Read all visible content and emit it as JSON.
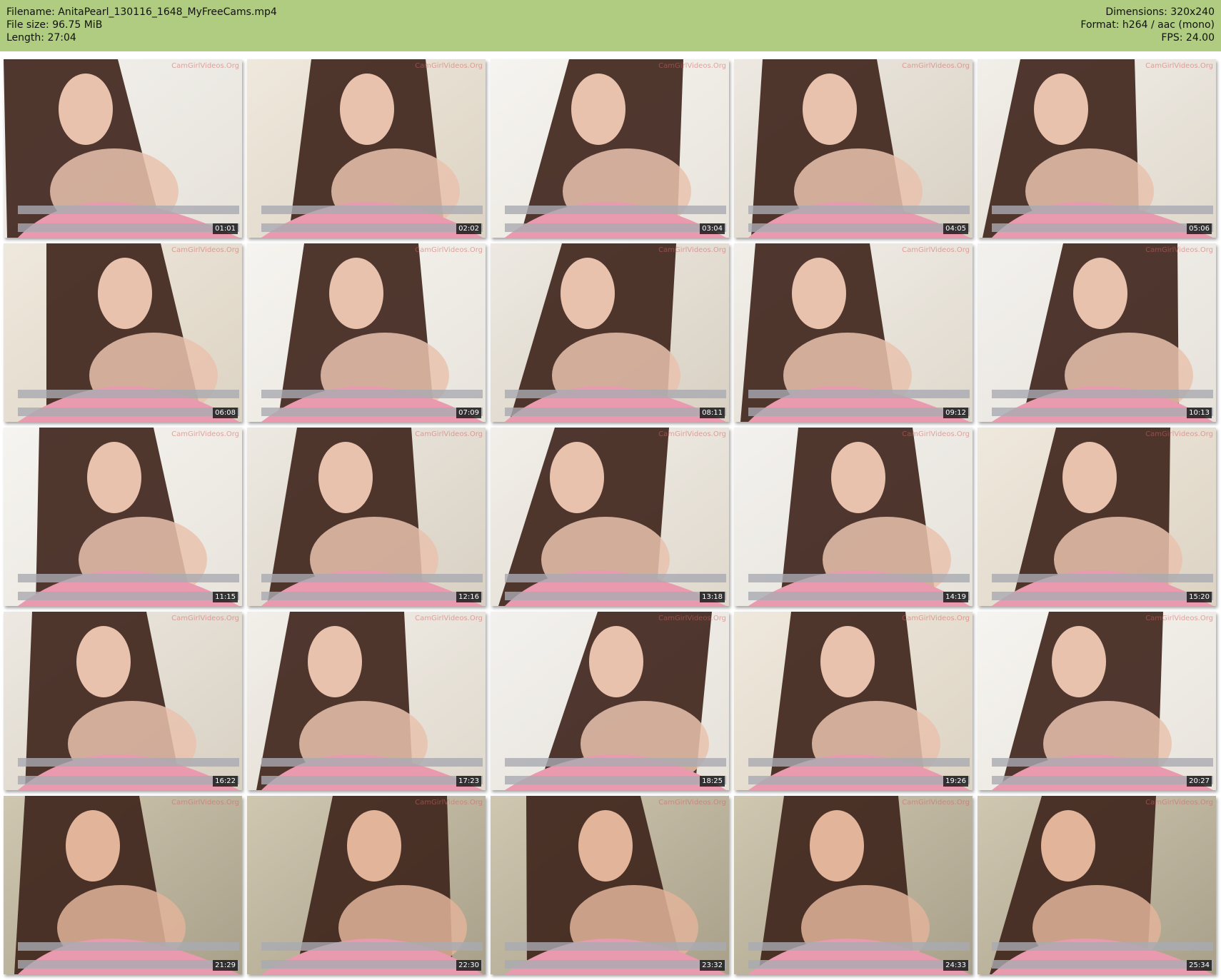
{
  "file_info": {
    "filename_line": "Filename: AnitaPearl_130116_1648_MyFreeCams.mp4",
    "filesize_line": "File size: 96.75 MiB",
    "length_line": "Length: 27:04",
    "dimensions_line": "Dimensions: 320x240",
    "format_line": "Format: h264 / aac (mono)",
    "fps_line": "FPS: 24.00"
  },
  "watermark": "CamGirlVideos.Org",
  "colors": {
    "header_bg": "#b0cc80",
    "timestamp_bg": "#000000"
  },
  "thumbnails": [
    {
      "timestamp": "01:01"
    },
    {
      "timestamp": "02:02"
    },
    {
      "timestamp": "03:04"
    },
    {
      "timestamp": "04:05"
    },
    {
      "timestamp": "05:06"
    },
    {
      "timestamp": "06:08"
    },
    {
      "timestamp": "07:09"
    },
    {
      "timestamp": "08:11"
    },
    {
      "timestamp": "09:12"
    },
    {
      "timestamp": "10:13"
    },
    {
      "timestamp": "11:15"
    },
    {
      "timestamp": "12:16"
    },
    {
      "timestamp": "13:18"
    },
    {
      "timestamp": "14:19"
    },
    {
      "timestamp": "15:20"
    },
    {
      "timestamp": "16:22"
    },
    {
      "timestamp": "17:23"
    },
    {
      "timestamp": "18:25"
    },
    {
      "timestamp": "19:26"
    },
    {
      "timestamp": "20:27"
    },
    {
      "timestamp": "21:29"
    },
    {
      "timestamp": "22:30"
    },
    {
      "timestamp": "23:32"
    },
    {
      "timestamp": "24:33"
    },
    {
      "timestamp": "25:34"
    }
  ]
}
